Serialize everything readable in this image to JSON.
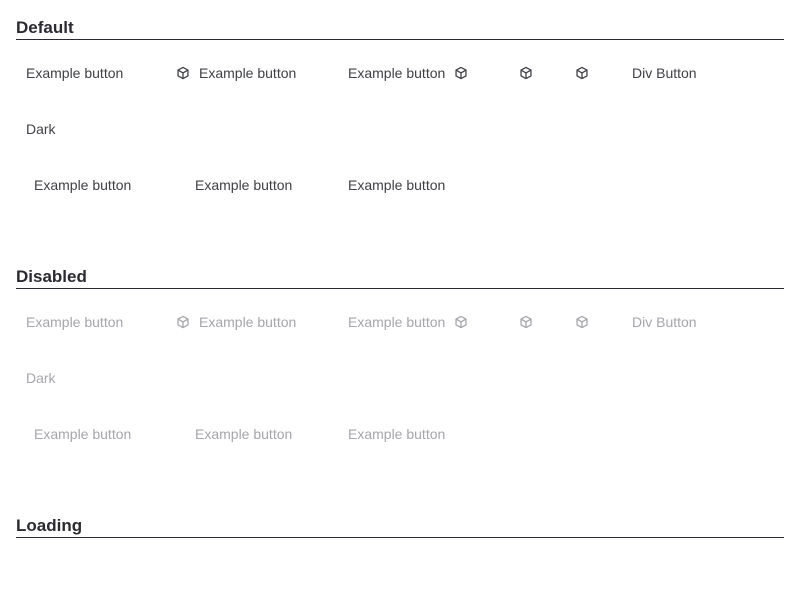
{
  "sections": {
    "default": {
      "title": "Default",
      "example_label": "Example button",
      "div_button_label": "Div Button",
      "dark_label": "Dark"
    },
    "disabled": {
      "title": "Disabled",
      "example_label": "Example button",
      "div_button_label": "Div Button",
      "dark_label": "Dark"
    },
    "loading": {
      "title": "Loading"
    }
  },
  "icons": {
    "button_icon": "cube-icon"
  },
  "colors": {
    "text": "#3f3f46",
    "heading": "#2a2a30",
    "disabled_text": "#a5a5ab"
  }
}
